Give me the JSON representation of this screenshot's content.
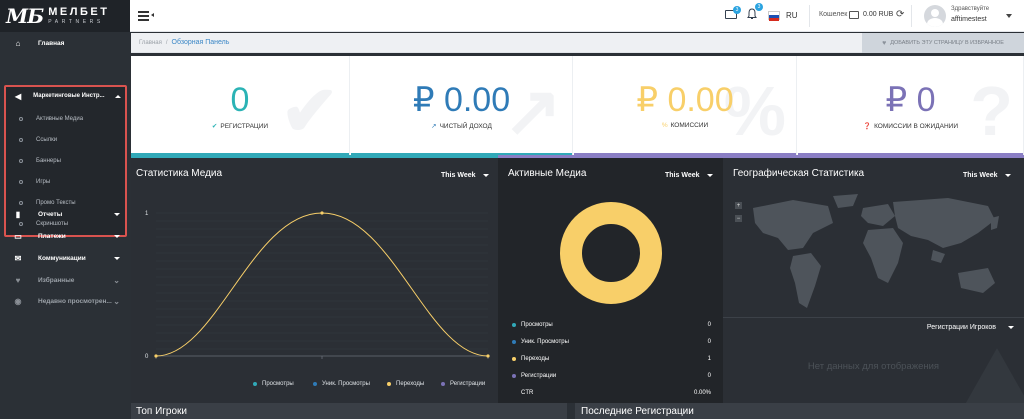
{
  "brand": {
    "logo_mark": "МБ",
    "name_line1": "МЕЛБЕТ",
    "name_line2": "PARTNERS"
  },
  "header": {
    "mail_badge": "3",
    "bell_badge": "3",
    "language": "RU",
    "wallet_label": "Кошелек",
    "balance": "0.00 RUB",
    "greeting": "Здравствуйте",
    "username": "afftimestest"
  },
  "sidebar": {
    "items": [
      {
        "label": "Главная"
      },
      {
        "label": "Маркетинговые Инстр..."
      },
      {
        "label": "Отчеты"
      },
      {
        "label": "Платежи"
      },
      {
        "label": "Коммуникации"
      },
      {
        "label": "Избранные"
      },
      {
        "label": "Недавно просмотрен..."
      }
    ],
    "submenu": [
      "Активные Медиа",
      "Ссылки",
      "Баннеры",
      "Игры",
      "Промо Тексты",
      "Скриншоты"
    ]
  },
  "breadcrumb": {
    "root": "Главная",
    "current": "Обзорная Панель",
    "favorite_btn": "ДОБАВИТЬ ЭТУ СТРАНИЦУ В ИЗБРАННОЕ"
  },
  "stats": [
    {
      "value": "0",
      "label": "РЕГИСТРАЦИИ",
      "color": "#2bb3b5",
      "bar": "#31a9b8"
    },
    {
      "value": "₽ 0.00",
      "label": "ЧИСТЫЙ ДОХОД",
      "color": "#2f7bb7",
      "bar": "#31a9b8"
    },
    {
      "value": "₽ 0.00",
      "label": "КОМИССИИ",
      "color": "#f8cf69",
      "bar": "#8a7ec4"
    },
    {
      "value": "₽ 0",
      "label": "КОМИССИИ В ОЖИДАНИИ",
      "color": "#7b72b6",
      "bar": "#8a7ec4"
    }
  ],
  "media_stats": {
    "title": "Статистика Медиа",
    "period": "This Week",
    "legend": [
      {
        "name": "Просмотры",
        "color": "#31a9b8"
      },
      {
        "name": "Уник. Просмотры",
        "color": "#2f7bb7"
      },
      {
        "name": "Переходы",
        "color": "#f8cf69"
      },
      {
        "name": "Регистрации",
        "color": "#7b72b6"
      }
    ]
  },
  "chart_data": {
    "type": "line",
    "x": [
      0,
      1,
      2
    ],
    "series": [
      {
        "name": "Переходы",
        "values": [
          0,
          1,
          0
        ],
        "color": "#f8cf69"
      }
    ],
    "ylim": [
      0,
      1
    ],
    "yticks": [
      "0",
      "1"
    ],
    "grid": true
  },
  "active_media": {
    "title": "Активные Медиа",
    "period": "This Week",
    "rows": [
      {
        "label": "Просмотры",
        "value": "0",
        "color": "#31a9b8"
      },
      {
        "label": "Уник. Просмотры",
        "value": "0",
        "color": "#2f7bb7"
      },
      {
        "label": "Переходы",
        "value": "1",
        "color": "#f8cf69"
      },
      {
        "label": "Регистрации",
        "value": "0",
        "color": "#7b72b6"
      },
      {
        "label": "CTR",
        "value": "0.00%",
        "color": ""
      }
    ]
  },
  "geo": {
    "title": "Географическая Статистика",
    "period": "This Week",
    "select_label": "Регистрации Игроков",
    "no_data": "Нет данных для отображения"
  },
  "bottom": {
    "left_title": "Топ Игроки",
    "right_title": "Последние Регистрации"
  }
}
